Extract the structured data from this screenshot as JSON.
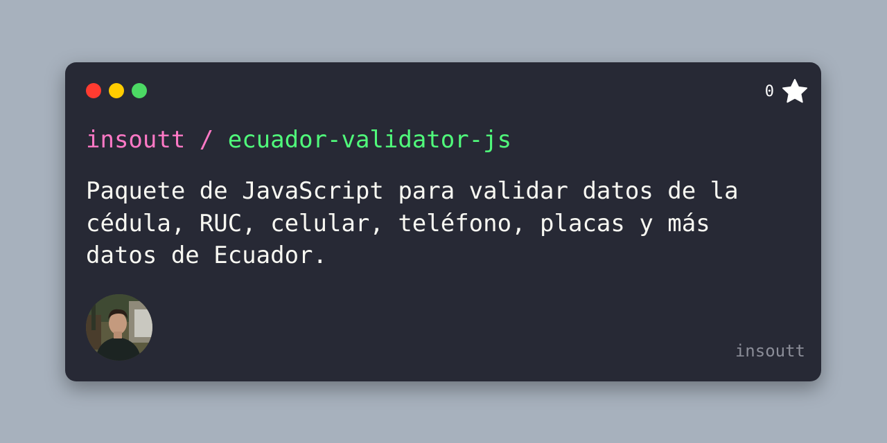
{
  "window_controls": {
    "close_color": "#ff3b30",
    "minimize_color": "#ffcc00",
    "maximize_color": "#4cd964"
  },
  "stars": {
    "count": "0",
    "icon": "star-icon"
  },
  "repo": {
    "owner": "insoutt",
    "separator": " / ",
    "name": "ecuador-validator-js"
  },
  "description": "Paquete de JavaScript para validar datos de la cédula, RUC, celular, teléfono, placas y más datos de Ecuador.",
  "avatar": {
    "icon": "avatar-photo"
  },
  "footer": {
    "username": "insoutt"
  },
  "colors": {
    "background": "#a7b1bd",
    "card": "#272935",
    "owner": "#ff79c6",
    "repo_name": "#50fa7b",
    "text": "#f8f8f2",
    "muted": "#8b8d98"
  }
}
